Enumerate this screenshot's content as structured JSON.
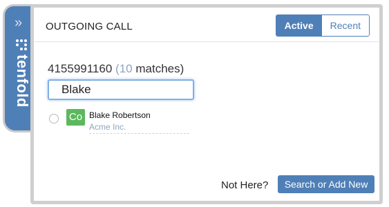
{
  "brand": {
    "name": "tenfold",
    "expand_icon": "double-chevron-right-icon"
  },
  "header": {
    "title": "OUTGOING CALL"
  },
  "tabs": [
    {
      "label": "Active",
      "active": true
    },
    {
      "label": "Recent",
      "active": false
    }
  ],
  "call": {
    "number": "4155991160",
    "matches_count": "10",
    "matches_label": "matches"
  },
  "search": {
    "value": "Blake"
  },
  "results": [
    {
      "badge": "Co",
      "name": "Blake Robertson",
      "company": "Acme Inc."
    }
  ],
  "footer": {
    "prompt": "Not Here?",
    "action_label": "Search or Add New"
  },
  "colors": {
    "accent": "#4f7fb7",
    "badge_green": "#5cb85c",
    "muted_text": "#8ea5bf"
  }
}
